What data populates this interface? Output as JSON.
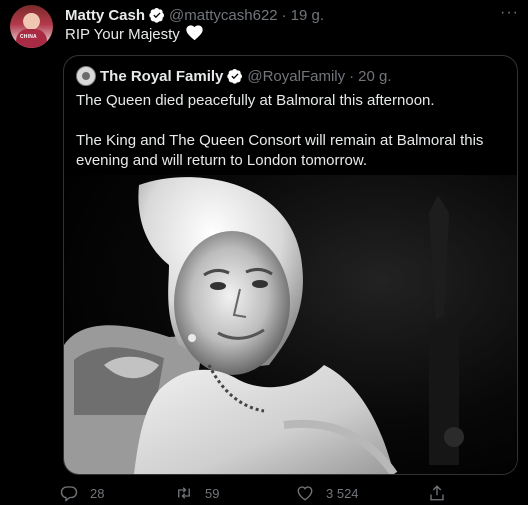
{
  "tweet": {
    "author_name": "Matty Cash",
    "author_handle": "@mattycash622",
    "separator": "·",
    "time": "19 g.",
    "text": "RIP Your Majesty",
    "avatar_text": "CHINA"
  },
  "quote": {
    "author_name": "The Royal Family",
    "author_handle": "@RoyalFamily",
    "separator": "·",
    "time": "20 g.",
    "text_1": "The Queen died peacefully at Balmoral this afternoon.",
    "text_2": "The King and The Queen Consort will remain at Balmoral this evening and will return to London tomorrow."
  },
  "actions": {
    "replies": "28",
    "retweets": "59",
    "likes": "3 524"
  },
  "colors": {
    "background": "#000000",
    "text": "#e7e9ea",
    "muted": "#71767b",
    "border": "#2f3336",
    "verified": "#ffffff"
  },
  "icons": [
    "verified-badge-icon",
    "more-icon",
    "white-heart-icon",
    "reply-icon",
    "retweet-icon",
    "like-icon",
    "share-icon"
  ]
}
